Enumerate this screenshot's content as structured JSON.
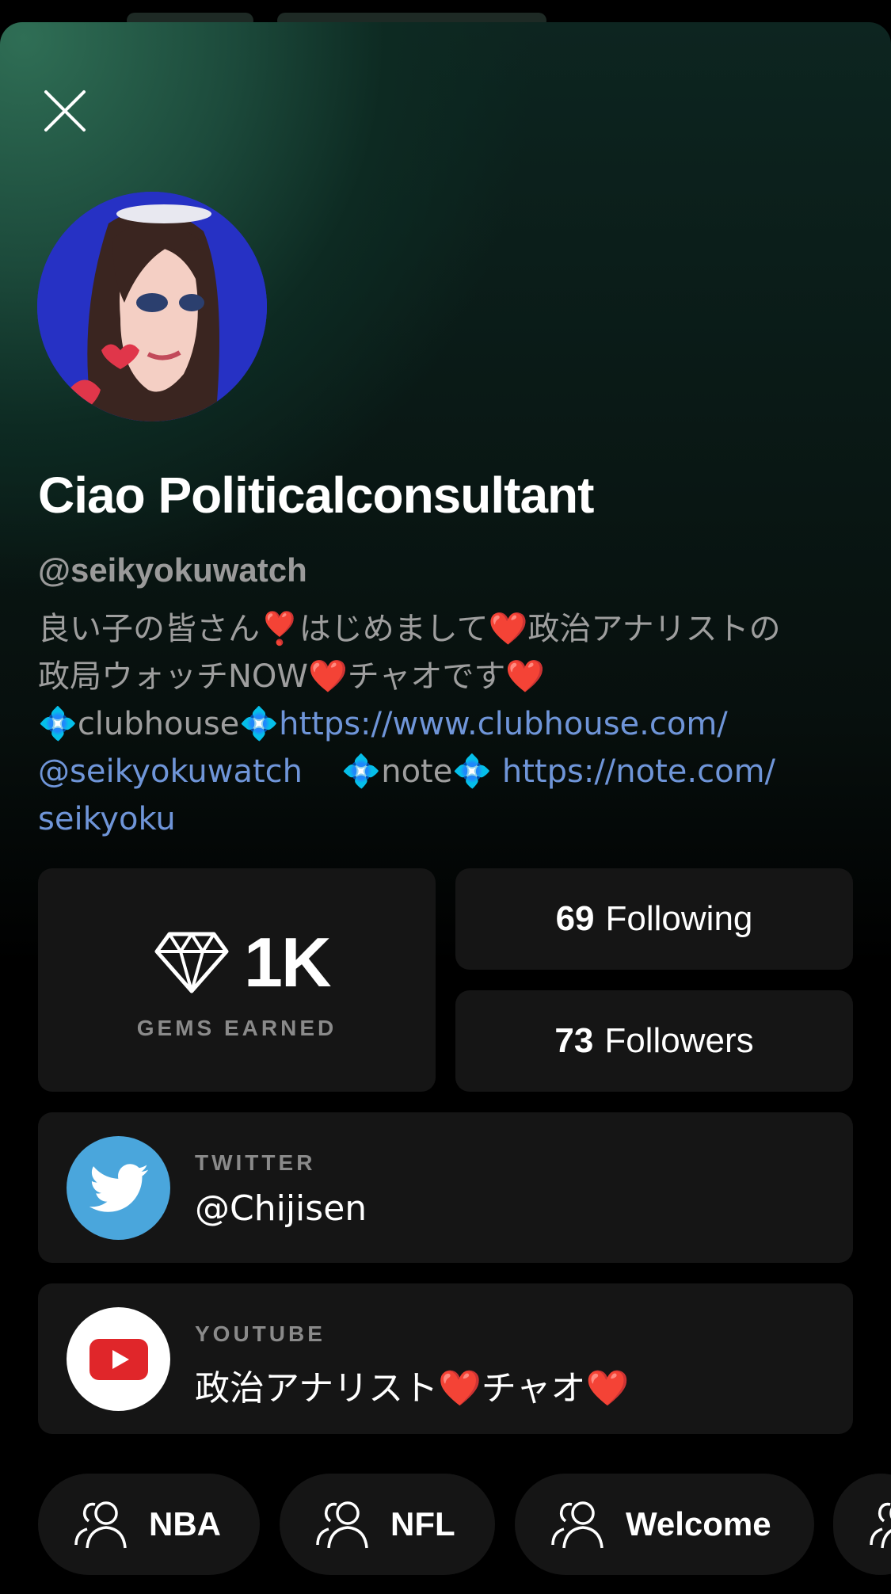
{
  "profile": {
    "name": "Ciao Politicalconsultant",
    "handle": "@seikyokuwatch",
    "bio_line1": "良い子の皆さん❣️はじめまして❤️政治アナリストの",
    "bio_line2": "政局ウォッチNOW❤️チャオです❤️",
    "bio_clubhouse_label": "clubhouse",
    "bio_clubhouse_link": "https://www.clubhouse.com/",
    "bio_clubhouse_handle": "@seikyokuwatch",
    "bio_note_label": "note",
    "bio_note_link": "https://note.com/",
    "bio_note_handle": "seikyoku"
  },
  "stats": {
    "gems_count": "1K",
    "gems_label": "GEMS EARNED",
    "following_count": "69",
    "following_label": "Following",
    "followers_count": "73",
    "followers_label": "Followers"
  },
  "social": {
    "twitter_label": "TWITTER",
    "twitter_value": "@Chijisen",
    "youtube_label": "YOUTUBE",
    "youtube_value": "政治アナリスト❤️チャオ❤️"
  },
  "clubs": [
    {
      "label": "NBA"
    },
    {
      "label": "NFL"
    },
    {
      "label": "Welcome"
    }
  ],
  "colors": {
    "accent_link": "#6f95d8",
    "twitter_blue": "#4aa6dc",
    "youtube_red": "#e0262a"
  }
}
